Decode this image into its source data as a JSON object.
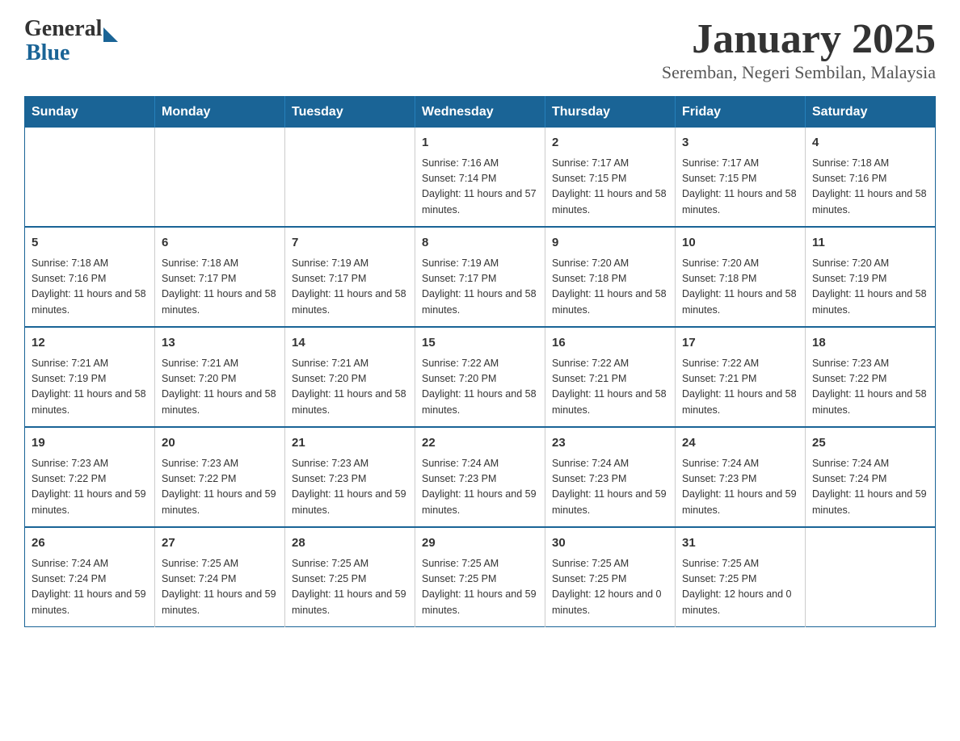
{
  "header": {
    "logo_general": "General",
    "logo_blue": "Blue",
    "month_title": "January 2025",
    "location": "Seremban, Negeri Sembilan, Malaysia"
  },
  "weekdays": [
    "Sunday",
    "Monday",
    "Tuesday",
    "Wednesday",
    "Thursday",
    "Friday",
    "Saturday"
  ],
  "weeks": [
    [
      {
        "day": "",
        "sunrise": "",
        "sunset": "",
        "daylight": ""
      },
      {
        "day": "",
        "sunrise": "",
        "sunset": "",
        "daylight": ""
      },
      {
        "day": "",
        "sunrise": "",
        "sunset": "",
        "daylight": ""
      },
      {
        "day": "1",
        "sunrise": "Sunrise: 7:16 AM",
        "sunset": "Sunset: 7:14 PM",
        "daylight": "Daylight: 11 hours and 57 minutes."
      },
      {
        "day": "2",
        "sunrise": "Sunrise: 7:17 AM",
        "sunset": "Sunset: 7:15 PM",
        "daylight": "Daylight: 11 hours and 58 minutes."
      },
      {
        "day": "3",
        "sunrise": "Sunrise: 7:17 AM",
        "sunset": "Sunset: 7:15 PM",
        "daylight": "Daylight: 11 hours and 58 minutes."
      },
      {
        "day": "4",
        "sunrise": "Sunrise: 7:18 AM",
        "sunset": "Sunset: 7:16 PM",
        "daylight": "Daylight: 11 hours and 58 minutes."
      }
    ],
    [
      {
        "day": "5",
        "sunrise": "Sunrise: 7:18 AM",
        "sunset": "Sunset: 7:16 PM",
        "daylight": "Daylight: 11 hours and 58 minutes."
      },
      {
        "day": "6",
        "sunrise": "Sunrise: 7:18 AM",
        "sunset": "Sunset: 7:17 PM",
        "daylight": "Daylight: 11 hours and 58 minutes."
      },
      {
        "day": "7",
        "sunrise": "Sunrise: 7:19 AM",
        "sunset": "Sunset: 7:17 PM",
        "daylight": "Daylight: 11 hours and 58 minutes."
      },
      {
        "day": "8",
        "sunrise": "Sunrise: 7:19 AM",
        "sunset": "Sunset: 7:17 PM",
        "daylight": "Daylight: 11 hours and 58 minutes."
      },
      {
        "day": "9",
        "sunrise": "Sunrise: 7:20 AM",
        "sunset": "Sunset: 7:18 PM",
        "daylight": "Daylight: 11 hours and 58 minutes."
      },
      {
        "day": "10",
        "sunrise": "Sunrise: 7:20 AM",
        "sunset": "Sunset: 7:18 PM",
        "daylight": "Daylight: 11 hours and 58 minutes."
      },
      {
        "day": "11",
        "sunrise": "Sunrise: 7:20 AM",
        "sunset": "Sunset: 7:19 PM",
        "daylight": "Daylight: 11 hours and 58 minutes."
      }
    ],
    [
      {
        "day": "12",
        "sunrise": "Sunrise: 7:21 AM",
        "sunset": "Sunset: 7:19 PM",
        "daylight": "Daylight: 11 hours and 58 minutes."
      },
      {
        "day": "13",
        "sunrise": "Sunrise: 7:21 AM",
        "sunset": "Sunset: 7:20 PM",
        "daylight": "Daylight: 11 hours and 58 minutes."
      },
      {
        "day": "14",
        "sunrise": "Sunrise: 7:21 AM",
        "sunset": "Sunset: 7:20 PM",
        "daylight": "Daylight: 11 hours and 58 minutes."
      },
      {
        "day": "15",
        "sunrise": "Sunrise: 7:22 AM",
        "sunset": "Sunset: 7:20 PM",
        "daylight": "Daylight: 11 hours and 58 minutes."
      },
      {
        "day": "16",
        "sunrise": "Sunrise: 7:22 AM",
        "sunset": "Sunset: 7:21 PM",
        "daylight": "Daylight: 11 hours and 58 minutes."
      },
      {
        "day": "17",
        "sunrise": "Sunrise: 7:22 AM",
        "sunset": "Sunset: 7:21 PM",
        "daylight": "Daylight: 11 hours and 58 minutes."
      },
      {
        "day": "18",
        "sunrise": "Sunrise: 7:23 AM",
        "sunset": "Sunset: 7:22 PM",
        "daylight": "Daylight: 11 hours and 58 minutes."
      }
    ],
    [
      {
        "day": "19",
        "sunrise": "Sunrise: 7:23 AM",
        "sunset": "Sunset: 7:22 PM",
        "daylight": "Daylight: 11 hours and 59 minutes."
      },
      {
        "day": "20",
        "sunrise": "Sunrise: 7:23 AM",
        "sunset": "Sunset: 7:22 PM",
        "daylight": "Daylight: 11 hours and 59 minutes."
      },
      {
        "day": "21",
        "sunrise": "Sunrise: 7:23 AM",
        "sunset": "Sunset: 7:23 PM",
        "daylight": "Daylight: 11 hours and 59 minutes."
      },
      {
        "day": "22",
        "sunrise": "Sunrise: 7:24 AM",
        "sunset": "Sunset: 7:23 PM",
        "daylight": "Daylight: 11 hours and 59 minutes."
      },
      {
        "day": "23",
        "sunrise": "Sunrise: 7:24 AM",
        "sunset": "Sunset: 7:23 PM",
        "daylight": "Daylight: 11 hours and 59 minutes."
      },
      {
        "day": "24",
        "sunrise": "Sunrise: 7:24 AM",
        "sunset": "Sunset: 7:23 PM",
        "daylight": "Daylight: 11 hours and 59 minutes."
      },
      {
        "day": "25",
        "sunrise": "Sunrise: 7:24 AM",
        "sunset": "Sunset: 7:24 PM",
        "daylight": "Daylight: 11 hours and 59 minutes."
      }
    ],
    [
      {
        "day": "26",
        "sunrise": "Sunrise: 7:24 AM",
        "sunset": "Sunset: 7:24 PM",
        "daylight": "Daylight: 11 hours and 59 minutes."
      },
      {
        "day": "27",
        "sunrise": "Sunrise: 7:25 AM",
        "sunset": "Sunset: 7:24 PM",
        "daylight": "Daylight: 11 hours and 59 minutes."
      },
      {
        "day": "28",
        "sunrise": "Sunrise: 7:25 AM",
        "sunset": "Sunset: 7:25 PM",
        "daylight": "Daylight: 11 hours and 59 minutes."
      },
      {
        "day": "29",
        "sunrise": "Sunrise: 7:25 AM",
        "sunset": "Sunset: 7:25 PM",
        "daylight": "Daylight: 11 hours and 59 minutes."
      },
      {
        "day": "30",
        "sunrise": "Sunrise: 7:25 AM",
        "sunset": "Sunset: 7:25 PM",
        "daylight": "Daylight: 12 hours and 0 minutes."
      },
      {
        "day": "31",
        "sunrise": "Sunrise: 7:25 AM",
        "sunset": "Sunset: 7:25 PM",
        "daylight": "Daylight: 12 hours and 0 minutes."
      },
      {
        "day": "",
        "sunrise": "",
        "sunset": "",
        "daylight": ""
      }
    ]
  ]
}
